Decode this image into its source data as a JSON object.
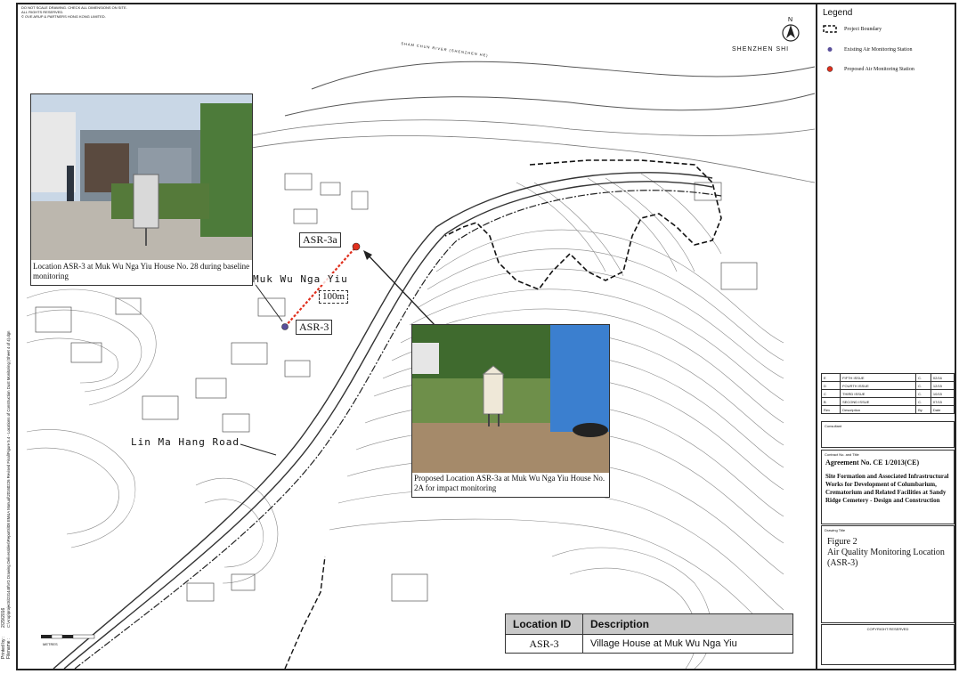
{
  "notes": {
    "line1": "DO NOT SCALE DRAWING. CHECK ALL DIMENSIONS ON SITE.",
    "line2": "ALL RIGHTS RESERVED.",
    "line3": "© OVE ARUP & PARTNERS HONG KONG LIMITED."
  },
  "margin": {
    "printed_by": "Printed by :",
    "date": "2/29/2016",
    "filename_label": "Filename :",
    "path": "C:\\Arup\\projects\\231448\\VG Drawing Deliverables\\Reports\\08 EM&A Manual\\20160226 Revised Final\\Figure 5.4 - Locations of Construction Dust Monitoring (Sheet 4 of 4).dgn"
  },
  "map": {
    "place_shenzhen": "SHENZHEN SHI",
    "river_label": "SHAM CHUN RIVER (SHENZHEN HE)",
    "place_mwny": "Muk Wu Nga Yiu",
    "road": "Lin Ma Hang Road",
    "asr3_label": "ASR-3",
    "asr3a_label": "ASR-3a",
    "distance_label": "100m",
    "scale_label": "METRES",
    "north_label": "N"
  },
  "photos": {
    "baseline_caption": "Location ASR-3 at Muk Wu Nga Yiu House No. 28 during baseline monitoring",
    "impact_caption": "Proposed Location ASR-3a at Muk Wu Nga Yiu House No. 2A for impact monitoring"
  },
  "location_table": {
    "headers": [
      "Location ID",
      "Description"
    ],
    "rows": [
      [
        "ASR-3",
        "Village House at  Muk Wu Nga Yiu"
      ]
    ]
  },
  "legend": {
    "title": "Legend",
    "items": [
      {
        "label": "Project Boundary",
        "symbol": "dashed-rectangle"
      },
      {
        "label": "Existing Air Monitoring Station",
        "symbol": "purple-dot",
        "color": "#5a4f9a"
      },
      {
        "label": "Proposed  Air Monitoring Station",
        "symbol": "red-dot",
        "color": "#e0301e"
      }
    ]
  },
  "revisions": {
    "rows": [
      [
        "E",
        "FIFTH ISSUE",
        "C.",
        "02/16"
      ],
      [
        "D",
        "FOURTH ISSUE",
        "C.",
        "12/15"
      ],
      [
        "C",
        "THIRD ISSUE",
        "C.",
        "10/15"
      ],
      [
        "B",
        "SECOND ISSUE",
        "C.",
        "07/15"
      ]
    ],
    "header": [
      "Rev",
      "Description",
      "By",
      "Date"
    ]
  },
  "title_block": {
    "consultant_label": "Consultant",
    "contract_label": "Contract No. and Title",
    "agreement": "Agreement No. CE 1/2013(CE)",
    "project_title": "Site Formation and Associated Infrastructural Works for Development of Columbarium, Crematorium and Related Facilities at Sandy Ridge Cemetery - Design and Construction",
    "drawing_title_label": "Drawing Title",
    "figure_no": "Figure 2",
    "figure_title": "Air Quality Monitoring Location (ASR-3)",
    "copyright": "COPYRIGHT RESERVED"
  },
  "colors": {
    "existing_station": "#5a4f9a",
    "proposed_station": "#e0301e",
    "link_line": "#e0301e",
    "table_header": "#c8c8c8"
  }
}
